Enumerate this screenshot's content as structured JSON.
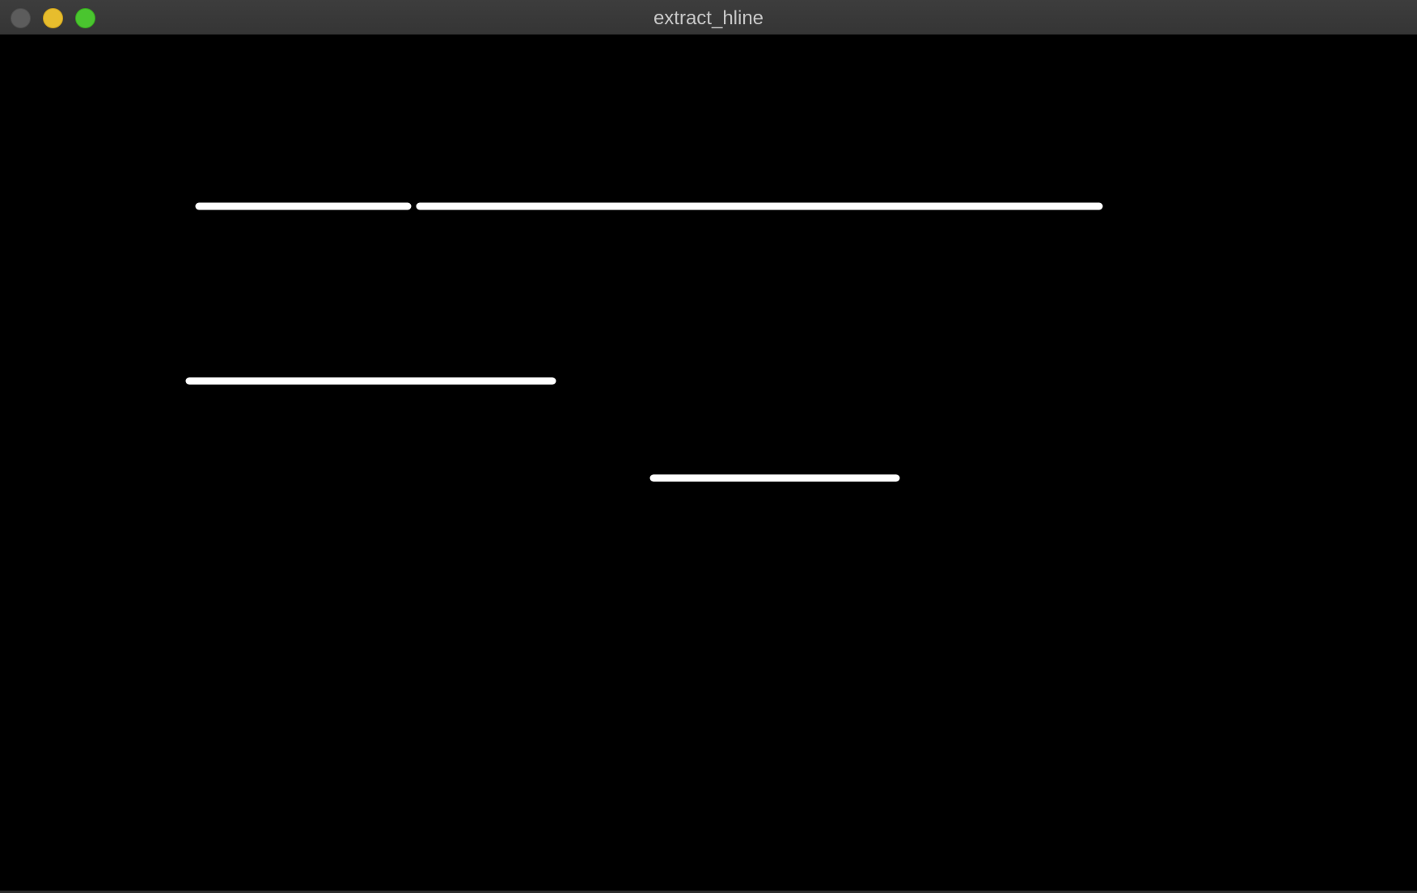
{
  "window": {
    "title": "extract_hline",
    "buttons": {
      "close": "close-button",
      "minimize": "minimize-button",
      "zoom": "zoom-button"
    },
    "colors": {
      "close": "#5c5c5c",
      "minimize": "#e7bd2d",
      "zoom": "#4ac52f",
      "titlebar": "#3a3a3a",
      "canvas_background": "#000000",
      "line_color": "#ffffff"
    }
  }
}
